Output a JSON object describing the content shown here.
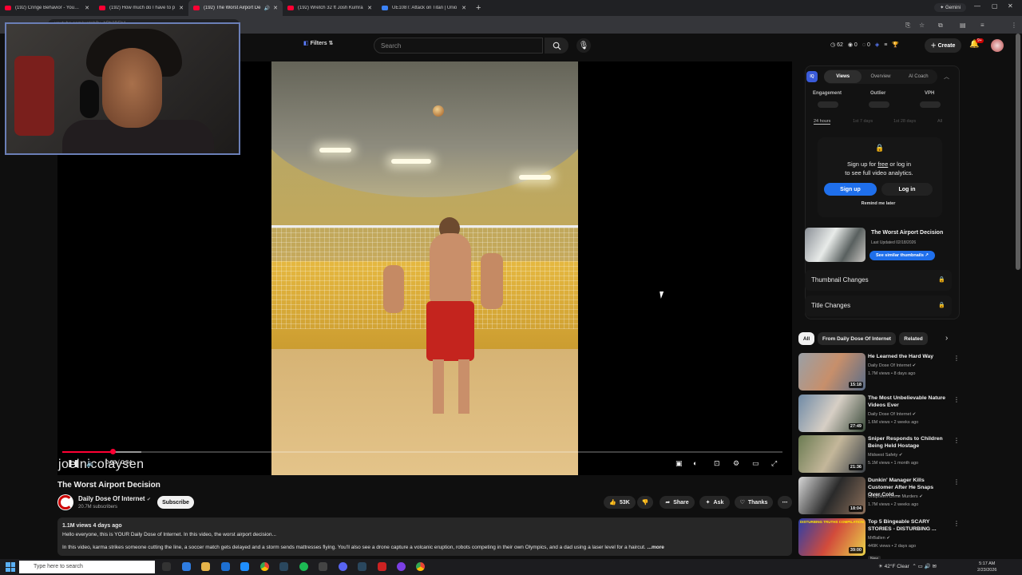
{
  "browser": {
    "tabs": [
      {
        "title": "(192) Cringe Behavior - YouTube",
        "active": false
      },
      {
        "title": "(192) How much do I have to p",
        "active": false
      },
      {
        "title": "(192) The Worst Airport De",
        "active": true
      },
      {
        "title": "(192) Wretch 32 ft Josh Kumra",
        "active": false
      },
      {
        "title": "UE108T: Attack on Titan | Unio",
        "active": false
      }
    ],
    "new_tab": "+",
    "gemini_label": "Gemini",
    "address": "youtube.com/watch?v=bPh3BFh1"
  },
  "header": {
    "filters_label": "Filters",
    "search_placeholder": "Search",
    "stats": [
      "62",
      "0",
      "0"
    ],
    "create_label": "Create",
    "notif_badge": "9+"
  },
  "player": {
    "watermark": "joelnicolaysen",
    "time": "0:08 / 0:34",
    "progress": 0.07
  },
  "video": {
    "title": "The Worst Airport Decision",
    "channel": "Daily Dose Of Internet",
    "subscribers": "20.7M subscribers",
    "subscribe_label": "Subscribe",
    "likes": "53K",
    "share_label": "Share",
    "ask_label": "Ask",
    "thanks_label": "Thanks",
    "views_date": "1.1M views  4 days ago",
    "desc_line1": "Hello everyone, this is YOUR Daily Dose of Internet. In this video, the worst airport decision...",
    "desc_line2": "In this video, karma strikes someone cutting the line, a soccer match gets delayed and a storm sends mattresses flying. You'll also see a drone capture a volcanic eruption, robots competing in their own Olympics, and a dad using a laser level for a haircut.",
    "more_label": "...more"
  },
  "vidiq": {
    "tabs": [
      "Views",
      "Overview",
      "AI Coach"
    ],
    "metrics": [
      "Engagement",
      "Outlier",
      "VPH"
    ],
    "ranges": [
      "24 hours",
      "1st 7 days",
      "1st 28 days",
      "All"
    ],
    "lock_text_a": "Sign up for ",
    "lock_text_free": "free",
    "lock_text_b": " or log in",
    "lock_text_c": "to see full video analytics.",
    "signup_label": "Sign up",
    "login_label": "Log in",
    "remind_label": "Remind me later",
    "card_title": "The Worst Airport Decision",
    "card_updated": "Last Updated 02/18/2026",
    "card_button": "See similar thumbnails",
    "thumb_changes": "Thumbnail Changes",
    "title_changes": "Title Changes"
  },
  "chips": [
    "All",
    "From Daily Dose Of Internet",
    "Related"
  ],
  "recommendations": [
    {
      "title": "He Learned the Hard Way",
      "channel": "Daily Dose Of Internet",
      "meta": "1.7M views • 8 days ago",
      "duration": "15:18",
      "colors": [
        "#9aa0a6",
        "#c78f6b",
        "#5a6d88"
      ]
    },
    {
      "title": "The Most Unbelievable Nature Videos Ever",
      "channel": "Daily Dose Of Internet",
      "meta": "1.6M views • 2 weeks ago",
      "duration": "27:49",
      "colors": [
        "#6f8aa6",
        "#d7cfc5",
        "#3a4a3a"
      ]
    },
    {
      "title": "Sniper Responds to Children Being Held Hostage",
      "channel": "Midwest Safety",
      "meta": "5.1M views • 1 month ago",
      "duration": "21:36",
      "colors": [
        "#6b7b52",
        "#c4b79a",
        "#3a3f46"
      ]
    },
    {
      "title": "Dunkin' Manager Kills Customer After He Snaps Over Cold ...",
      "channel": "Unspoken Crime Murders",
      "meta": "1.7M views • 2 weeks ago",
      "duration": "18:04",
      "colors": [
        "#d8d8d8",
        "#2a2a2a",
        "#8c6f5a"
      ]
    },
    {
      "title": "Top 5 Bingeable SCARY STORIES - DISTURBING ...",
      "channel": "MrBallen",
      "meta": "449K views • 2 days ago",
      "duration": "39:00",
      "colors": [
        "#2c3fa8",
        "#d24b3b",
        "#e9d34a"
      ],
      "badge": "New",
      "overlay": "DISTURBING TRUTHS COMPILATION"
    }
  ],
  "taskbar": {
    "search_placeholder": "Type here to search",
    "weather": "42°F  Clear",
    "time": "5:17 AM",
    "date": "2/23/2026"
  },
  "colors": {
    "accent": "#ff0033",
    "vidiq_blue": "#1f6feb",
    "panel": "#121212"
  }
}
